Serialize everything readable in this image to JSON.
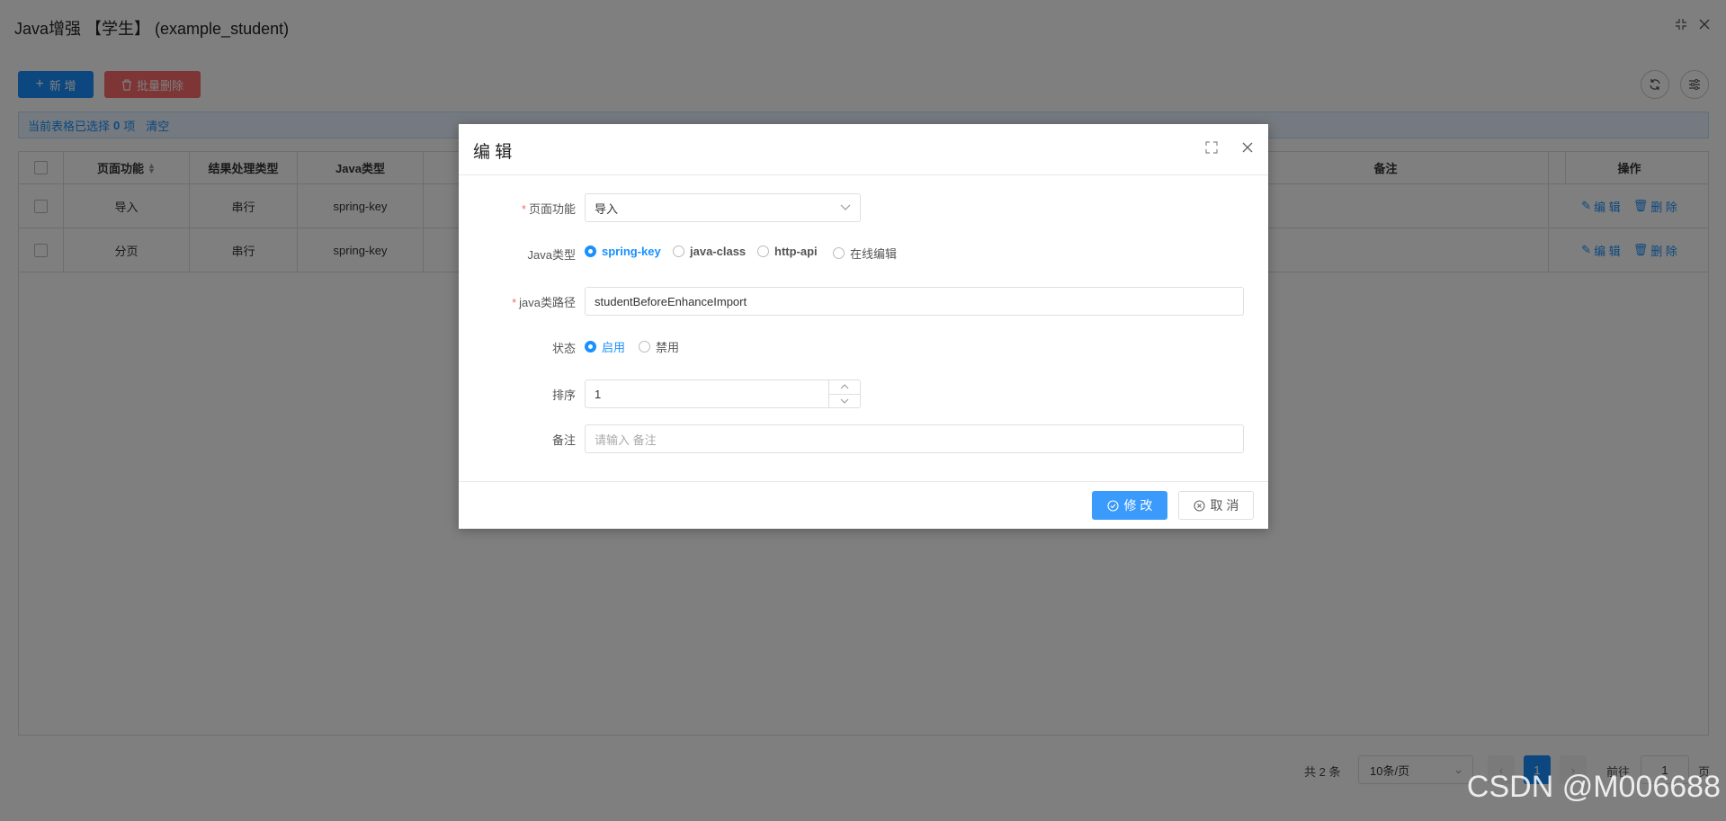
{
  "page": {
    "title": "Java增强 【学生】 (example_student)",
    "add_label": "新 增",
    "batch_delete_label": "批量删除",
    "selection": {
      "prefix": "当前表格已选择",
      "count": "0",
      "suffix": "项",
      "clear": "清空"
    },
    "table": {
      "headers": [
        "页面功能",
        "结果处理类型",
        "Java类型",
        "备注",
        "操作"
      ],
      "rows": [
        {
          "function": "导入",
          "result_type": "串行",
          "java_type": "spring-key"
        },
        {
          "function": "分页",
          "result_type": "串行",
          "java_type": "spring-key"
        }
      ],
      "edit_label": "编 辑",
      "delete_label": "删 除"
    },
    "pagination": {
      "total": "共 2 条",
      "page_size": "10条/页",
      "current_page": "1",
      "goto_prefix": "前往",
      "goto_value": "1",
      "goto_suffix": "页"
    }
  },
  "dialog": {
    "title": "编 辑",
    "fields": {
      "function": {
        "label": "页面功能",
        "value": "导入"
      },
      "java_type": {
        "label": "Java类型",
        "options": [
          "spring-key",
          "java-class",
          "http-api",
          "在线编辑"
        ],
        "selected": "spring-key"
      },
      "java_path": {
        "label": "java类路径",
        "value": "studentBeforeEnhanceImport"
      },
      "status": {
        "label": "状态",
        "options": [
          "启用",
          "禁用"
        ],
        "selected": "启用"
      },
      "sort": {
        "label": "排序",
        "value": "1"
      },
      "remark": {
        "label": "备注",
        "placeholder": "请输入 备注"
      }
    },
    "submit_label": "修 改",
    "cancel_label": "取 消"
  },
  "watermark": "CSDN @M006688",
  "colors": {
    "primary": "#1890ff",
    "danger": "#fa6a6a",
    "required": "#f56c6c"
  }
}
